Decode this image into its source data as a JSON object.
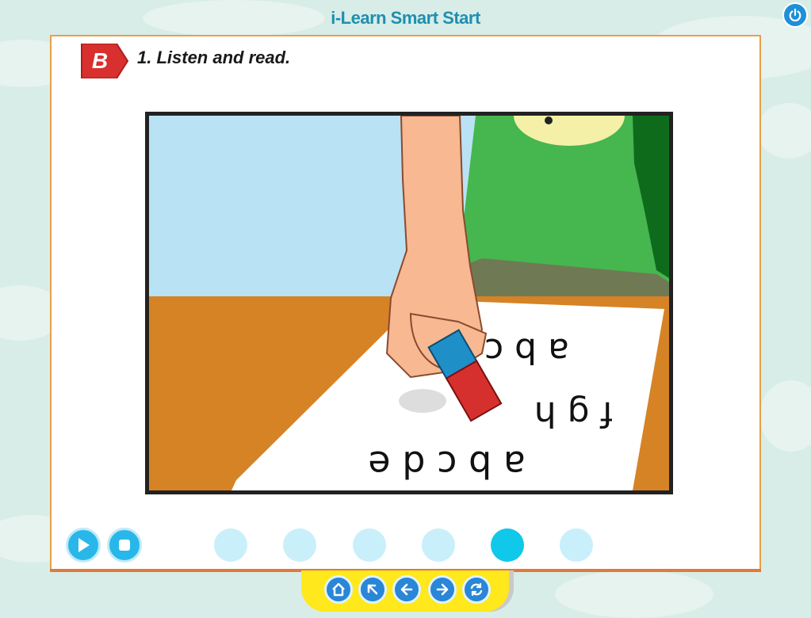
{
  "app": {
    "title": "i-Learn Smart Start"
  },
  "lesson": {
    "section_badge": "B",
    "instruction": "1. Listen and read."
  },
  "scene": {
    "description_icon": "illustration-hand-erasing-letters"
  },
  "controls": {
    "play_icon": "play-icon",
    "stop_icon": "stop-icon",
    "pages_total": 6,
    "active_page": 5
  },
  "nav": {
    "buttons": [
      "home-icon",
      "back-up-icon",
      "previous-icon",
      "next-icon",
      "refresh-icon"
    ]
  },
  "colors": {
    "accent_blue": "#29b7ea",
    "badge_red": "#d8302e",
    "panel_border": "#e6a04a",
    "tray_yellow": "#ffe81c"
  }
}
